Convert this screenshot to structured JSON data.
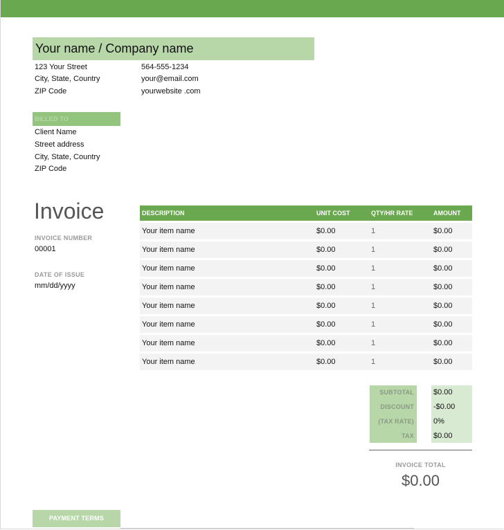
{
  "company": {
    "name": "Your name / Company name",
    "address": [
      "123 Your Street",
      "City, State, Country",
      "ZIP Code"
    ],
    "contact": [
      "564-555-1234",
      "your@email.com",
      "yourwebsite .com"
    ]
  },
  "billed_to": {
    "label": "BILLED TO",
    "lines": [
      "Client Name",
      "Street address",
      "City, State, Country",
      "ZIP Code"
    ]
  },
  "invoice": {
    "title": "Invoice",
    "number_label": "INVOICE NUMBER",
    "number": "00001",
    "date_label": "DATE OF ISSUE",
    "date": "mm/dd/yyyy"
  },
  "items": {
    "headers": {
      "description": "DESCRIPTION",
      "unit_cost": "UNIT COST",
      "qty": "QTY/HR RATE",
      "amount": "AMOUNT"
    },
    "rows": [
      {
        "description": "Your item name",
        "unit_cost": "$0.00",
        "qty": "1",
        "amount": "$0.00"
      },
      {
        "description": "Your item name",
        "unit_cost": "$0.00",
        "qty": "1",
        "amount": "$0.00"
      },
      {
        "description": "Your item name",
        "unit_cost": "$0.00",
        "qty": "1",
        "amount": "$0.00"
      },
      {
        "description": "Your item name",
        "unit_cost": "$0.00",
        "qty": "1",
        "amount": "$0.00"
      },
      {
        "description": "Your item name",
        "unit_cost": "$0.00",
        "qty": "1",
        "amount": "$0.00"
      },
      {
        "description": "Your item name",
        "unit_cost": "$0.00",
        "qty": "1",
        "amount": "$0.00"
      },
      {
        "description": "Your item name",
        "unit_cost": "$0.00",
        "qty": "1",
        "amount": "$0.00"
      },
      {
        "description": "Your item name",
        "unit_cost": "$0.00",
        "qty": "1",
        "amount": "$0.00"
      }
    ]
  },
  "totals": {
    "subtotal_label": "SUBTOTAL",
    "subtotal": "$0.00",
    "discount_label": "DISCOUNT",
    "discount": "-$0.00",
    "tax_rate_label": "(TAX RATE)",
    "tax_rate": "0%",
    "tax_label": "TAX",
    "tax": "$0.00",
    "invoice_total_label": "INVOICE TOTAL",
    "invoice_total": "$0.00"
  },
  "payment_terms_label": "PAYMENT TERMS",
  "colors": {
    "accent": "#6aa84f",
    "light_accent": "#b7d7a8",
    "mid_accent": "#93c47d",
    "pale_accent": "#d9ead3"
  }
}
